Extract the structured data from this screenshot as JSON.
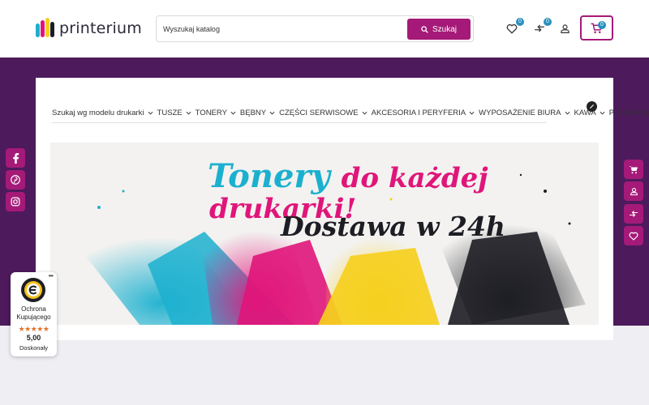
{
  "header": {
    "logo_text": "printerium",
    "search": {
      "placeholder": "Wyszukaj katalog",
      "button_label": "Szukaj"
    },
    "wishlist_count": "0",
    "compare_count": "0",
    "cart_count": "0"
  },
  "nav": {
    "items": [
      {
        "label": "Szukaj wg modelu drukarki",
        "dropdown": true
      },
      {
        "label": "TUSZE",
        "dropdown": true
      },
      {
        "label": "TONERY",
        "dropdown": true
      },
      {
        "label": "BĘBNY",
        "dropdown": true
      },
      {
        "label": "CZĘŚCI SERWISOWE",
        "dropdown": true
      },
      {
        "label": "AKCESORIA I PERYFERIA",
        "dropdown": true
      },
      {
        "label": "WYPOSAŻENIE BIURA",
        "dropdown": true
      },
      {
        "label": "KAWA",
        "dropdown": true
      },
      {
        "label": "POLECANE",
        "dropdown": false
      }
    ]
  },
  "banner": {
    "line1_a": "Tonery",
    "line1_b": "do każdej",
    "line2": "drukarki!",
    "line3": "Dostawa w 24h"
  },
  "social_icons": [
    "facebook-icon",
    "pinterest-icon",
    "instagram-icon"
  ],
  "side_icons": [
    "cart-icon",
    "user-icon",
    "compare-icon",
    "heart-icon"
  ],
  "trust_badge": {
    "title": "Ochrona Kupującego",
    "stars": "★★★★★",
    "score": "5,00",
    "label": "Doskonały"
  },
  "colors": {
    "brand": "#a51a78",
    "band": "#4d1a5c",
    "badge": "#2a8fbd",
    "cyan": "#1bb0cf",
    "magenta": "#e0157a",
    "yellow": "#f5cf1e",
    "black": "#1d1d24"
  }
}
